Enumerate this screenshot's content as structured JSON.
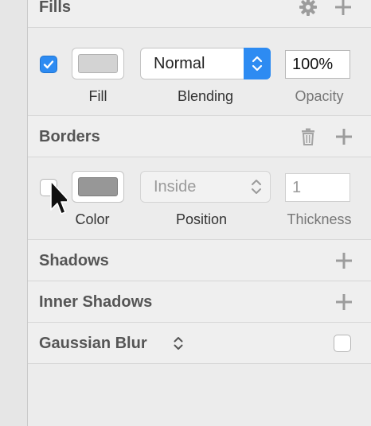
{
  "fills": {
    "title": "Fills",
    "enabled": true,
    "fill_color": "#d3d3d3",
    "blending_value": "Normal",
    "opacity_value": "100%",
    "fill_label": "Fill",
    "blending_label": "Blending",
    "opacity_label": "Opacity",
    "icons": [
      "gear-icon",
      "plus-icon"
    ]
  },
  "borders": {
    "title": "Borders",
    "enabled": false,
    "border_color": "#979797",
    "position_value": "Inside",
    "thickness_value": "1",
    "color_label": "Color",
    "position_label": "Position",
    "thickness_label": "Thickness",
    "icons": [
      "trash-icon",
      "plus-icon"
    ]
  },
  "shadows": {
    "title": "Shadows",
    "icons": [
      "plus-icon"
    ]
  },
  "inner_shadows": {
    "title": "Inner Shadows",
    "icons": [
      "plus-icon"
    ]
  },
  "gaussian_blur": {
    "title": "Gaussian Blur",
    "enabled": false
  },
  "colors": {
    "accent": "#2d8bf2",
    "panel_bg": "#ececec",
    "header_text": "#555555"
  }
}
